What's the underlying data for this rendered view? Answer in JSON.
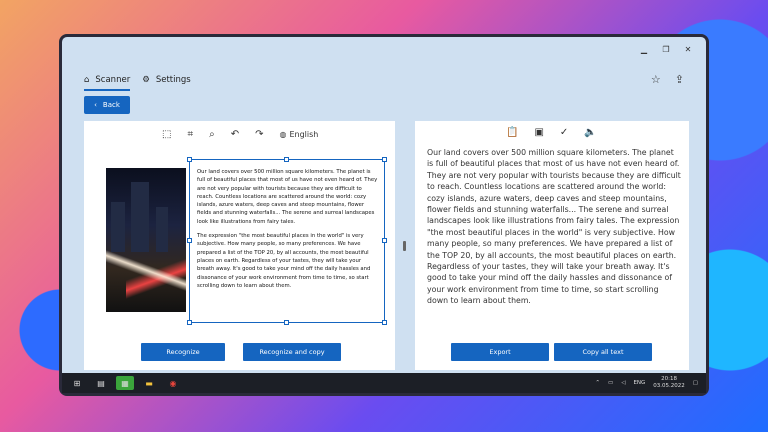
{
  "tabs": [
    {
      "label": "Scanner",
      "icon": "scanner-icon",
      "active": true
    },
    {
      "label": "Settings",
      "icon": "gear-icon",
      "active": false
    }
  ],
  "back_label": "Back",
  "left_toolbar": {
    "icons": [
      "select-area-icon",
      "crop-icon",
      "zoom-icon",
      "undo-icon",
      "redo-icon",
      "globe-icon"
    ],
    "language": "English"
  },
  "recognized_paragraph_1": "Our land covers over 500 million square kilometers. The planet is full of beautiful places that most of us have not even heard of. They are not very popular with tourists because they are difficult to reach. Countless locations are scattered around the world: cozy islands, azure waters, deep caves and steep mountains, flower fields and stunning waterfalls... The serene and surreal landscapes look like illustrations from fairy tales.",
  "recognized_paragraph_2": "The expression \"the most beautiful places in the world\" is very subjective. How many people, so many preferences. We have prepared a list of the TOP 20, by all accounts, the most beautiful places on earth. Regardless of your tastes, they will take your breath away. It's good to take your mind off the daily hassles and dissonance of your work environment from time to time, so start scrolling down to learn about them.",
  "output_text": "Our land covers over 500 million square kilometers. The planet is full of beautiful places that most of us have not even heard of. They are not very popular with tourists because they are difficult to reach. Countless locations are scattered around the world: cozy islands, azure waters, deep caves and steep mountains, flower fields and stunning waterfalls... The serene and surreal landscapes look like illustrations from fairy tales. The expression \"the most beautiful places in the world\" is very subjective. How many people, so many preferences. We have prepared a list of the TOP 20, by all accounts, the most beautiful places on earth. Regardless of your tastes, they will take your breath away. It's good to take your mind off the daily hassles and dissonance of your work environment from time to time, so start scrolling down to learn about them.",
  "left_buttons": {
    "recognize": "Recognize",
    "recognize_copy": "Recognize and copy"
  },
  "right_buttons": {
    "export": "Export",
    "copy_all": "Copy all text"
  },
  "right_toolbar_icons": [
    "paste-icon",
    "save-icon",
    "check-icon",
    "speaker-icon"
  ],
  "taskbar": {
    "lang": "ENG",
    "time": "20:18",
    "date": "03.05.2022"
  },
  "colors": {
    "accent": "#1565c0",
    "window_bg": "#cfe0f1"
  }
}
